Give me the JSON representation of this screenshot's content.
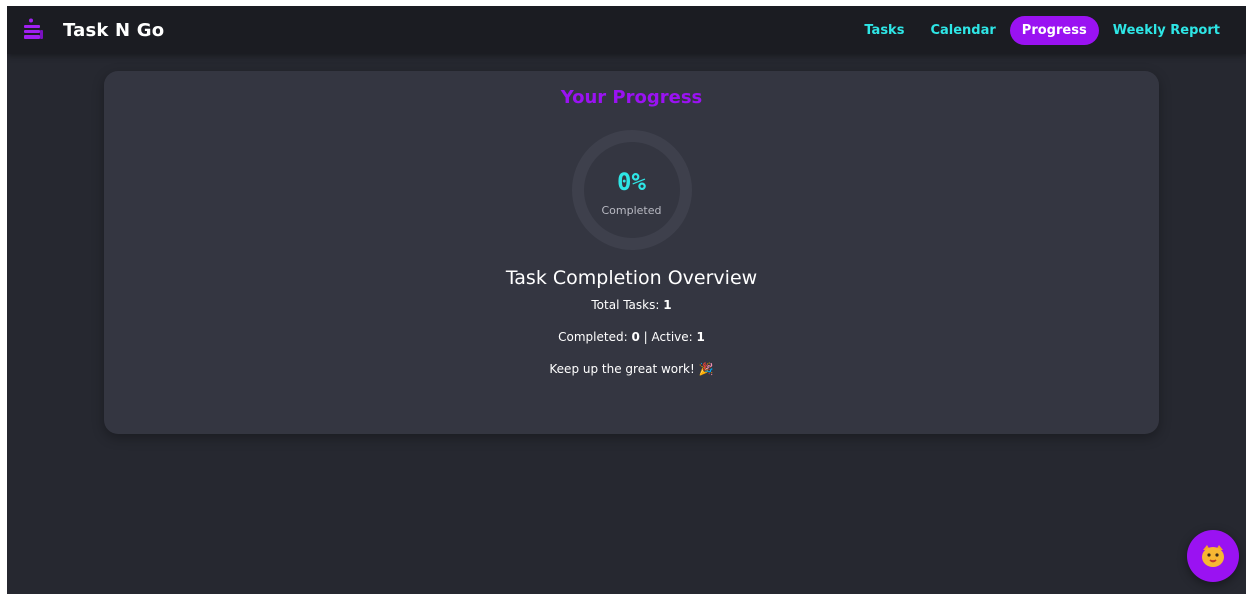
{
  "app": {
    "title": "Task N Go",
    "logo_icon": "inbox-tray-icon",
    "accent_color": "#9a12f2",
    "link_color": "#2ee6e6"
  },
  "nav": {
    "items": [
      {
        "label": "Tasks",
        "active": false
      },
      {
        "label": "Calendar",
        "active": false
      },
      {
        "label": "Progress",
        "active": true
      },
      {
        "label": "Weekly Report",
        "active": false
      }
    ]
  },
  "progress": {
    "title": "Your Progress",
    "percent_text": "0%",
    "percent_value": 0,
    "completed_label": "Completed",
    "overview_title": "Task Completion Overview",
    "total_label": "Total Tasks:",
    "total_value": "1",
    "completed_text": "Completed:",
    "completed_value": "0",
    "separator": "|",
    "active_text": "Active:",
    "active_value": "1",
    "encouragement": "Keep up the great work! 🎉"
  },
  "assistant": {
    "icon": "cat-face-icon"
  }
}
